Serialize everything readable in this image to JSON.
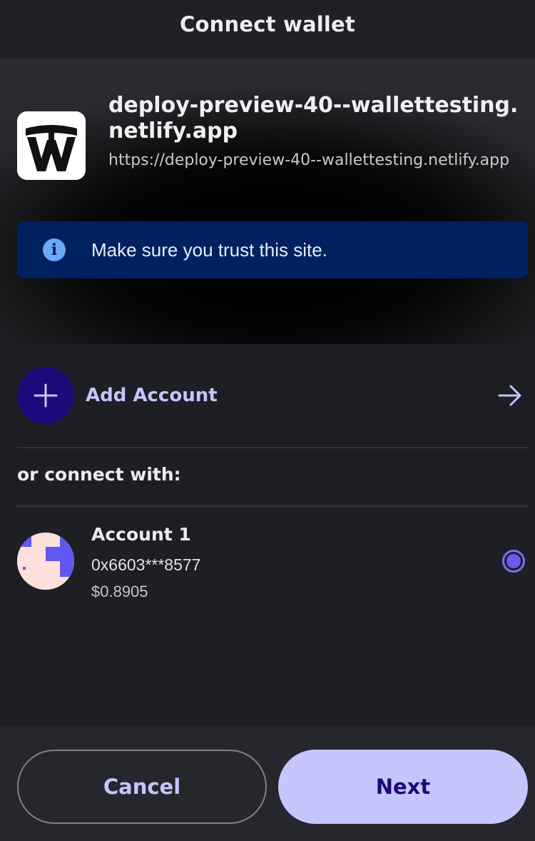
{
  "header": {
    "title": "Connect wallet"
  },
  "site": {
    "name": "deploy-preview-40--wallettesting.netlify.app",
    "url": "https://deploy-preview-40--wallettesting.netlify.app",
    "logo_icon": "wallettesting-logo-icon"
  },
  "notice": {
    "icon": "info-icon",
    "text": "Make sure you trust this site."
  },
  "add_account": {
    "label": "Add Account",
    "icon": "plus-icon",
    "arrow_icon": "arrow-right-icon"
  },
  "connect_with": {
    "label": "or connect with:"
  },
  "accounts": [
    {
      "name": "Account 1",
      "address": "0x6603***8577",
      "balance": "$0.8905",
      "selected": true
    }
  ],
  "footer": {
    "cancel_label": "Cancel",
    "next_label": "Next"
  },
  "colors": {
    "background": "#1e1f25",
    "notice_bg": "#00215f",
    "accent": "#c4c6fd",
    "accent_dark": "#1d0a7a",
    "radio": "#6a5cf0"
  }
}
